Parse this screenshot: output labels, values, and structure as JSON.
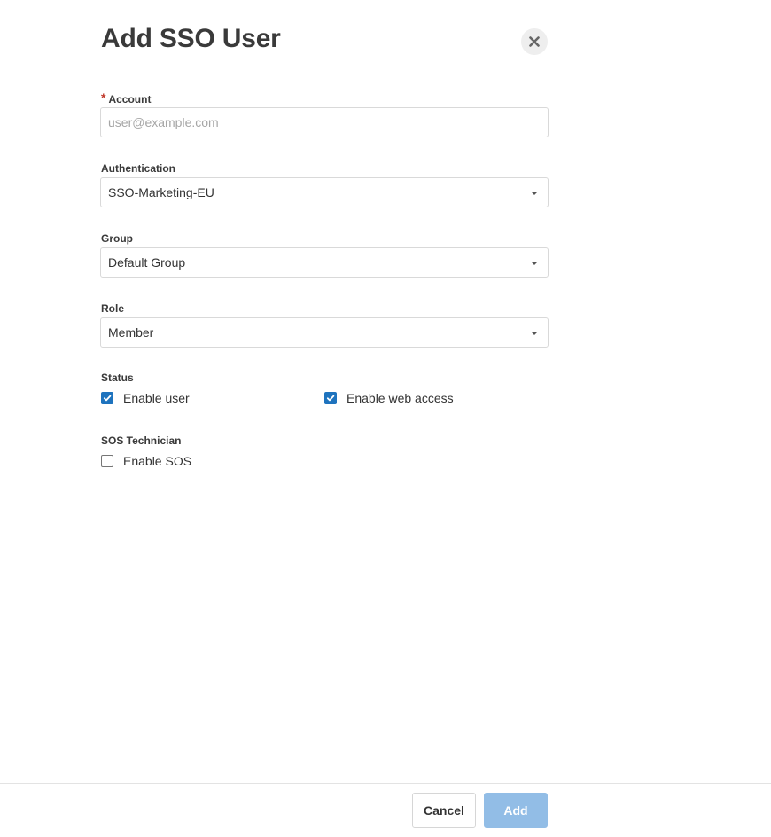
{
  "dialog": {
    "title": "Add SSO User",
    "close_label": "Close"
  },
  "form": {
    "account": {
      "required_mark": "*",
      "label": "Account",
      "value": "",
      "placeholder": "user@example.com"
    },
    "authentication": {
      "label": "Authentication",
      "selected": "SSO-Marketing-EU"
    },
    "group": {
      "label": "Group",
      "selected": "Default Group"
    },
    "role": {
      "label": "Role",
      "selected": "Member"
    },
    "status": {
      "label": "Status",
      "enable_user": {
        "label": "Enable user",
        "checked": true
      },
      "enable_web_access": {
        "label": "Enable web access",
        "checked": true
      }
    },
    "sos_technician": {
      "label": "SOS Technician",
      "enable_sos": {
        "label": "Enable SOS",
        "checked": false
      }
    }
  },
  "footer": {
    "cancel_label": "Cancel",
    "add_label": "Add"
  },
  "colors": {
    "accent": "#1e73be",
    "primary_button_disabled": "#92bde6",
    "required": "#c0392b"
  },
  "icons": {
    "close": "close-icon",
    "dropdown": "caret-down-icon",
    "check": "check-icon"
  }
}
